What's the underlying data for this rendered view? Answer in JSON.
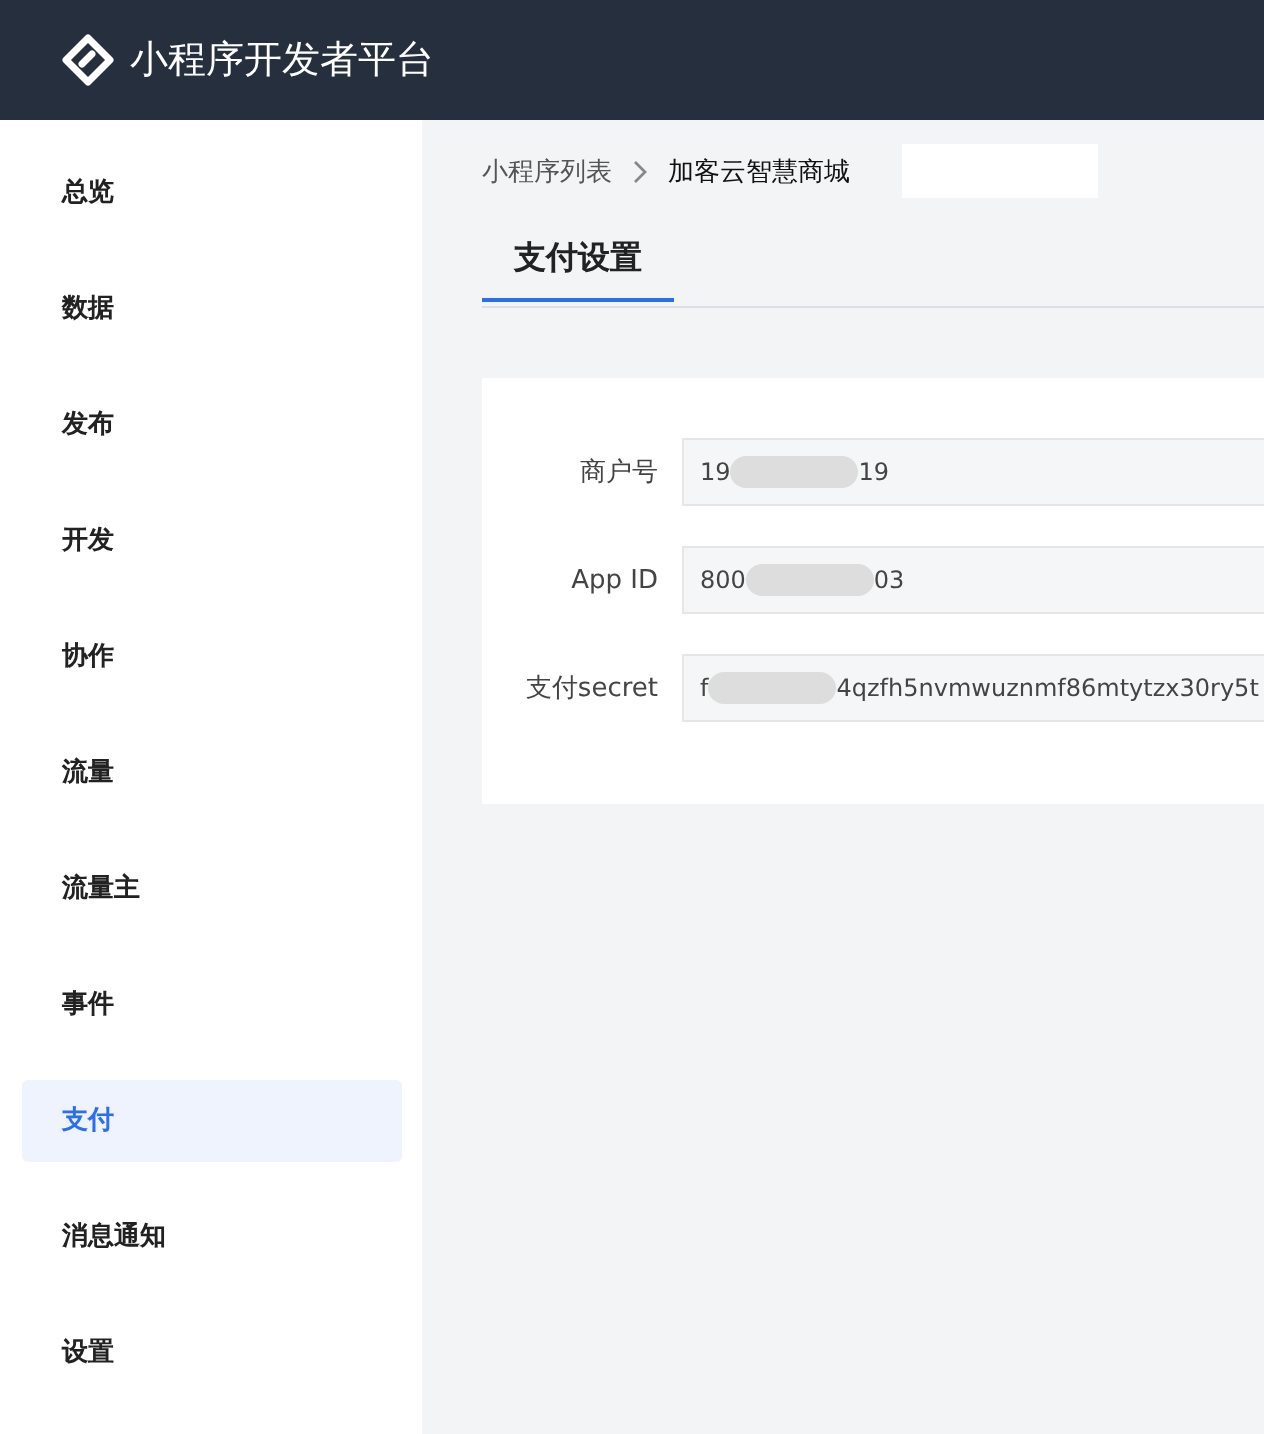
{
  "header": {
    "title": "小程序开发者平台"
  },
  "sidebar": {
    "items": [
      {
        "label": "总览",
        "selected": false
      },
      {
        "label": "数据",
        "selected": false
      },
      {
        "label": "发布",
        "selected": false
      },
      {
        "label": "开发",
        "selected": false
      },
      {
        "label": "协作",
        "selected": false
      },
      {
        "label": "流量",
        "selected": false
      },
      {
        "label": "流量主",
        "selected": false
      },
      {
        "label": "事件",
        "selected": false
      },
      {
        "label": "支付",
        "selected": true
      },
      {
        "label": "消息通知",
        "selected": false
      },
      {
        "label": "设置",
        "selected": false
      }
    ]
  },
  "breadcrumb": [
    "小程序列表",
    "加客云智慧商城"
  ],
  "tabs": [
    {
      "label": "支付设置",
      "selected": true
    }
  ],
  "form": {
    "fields": [
      {
        "label": "商户号",
        "value_start": "19",
        "value_end": "19"
      },
      {
        "label": "App ID",
        "value_start": "800",
        "value_end": "03"
      },
      {
        "label": "支付secret",
        "value_start": "f",
        "value_end": "4qzfh5nvmwuznmf86mtytzx30ry5t"
      }
    ]
  }
}
